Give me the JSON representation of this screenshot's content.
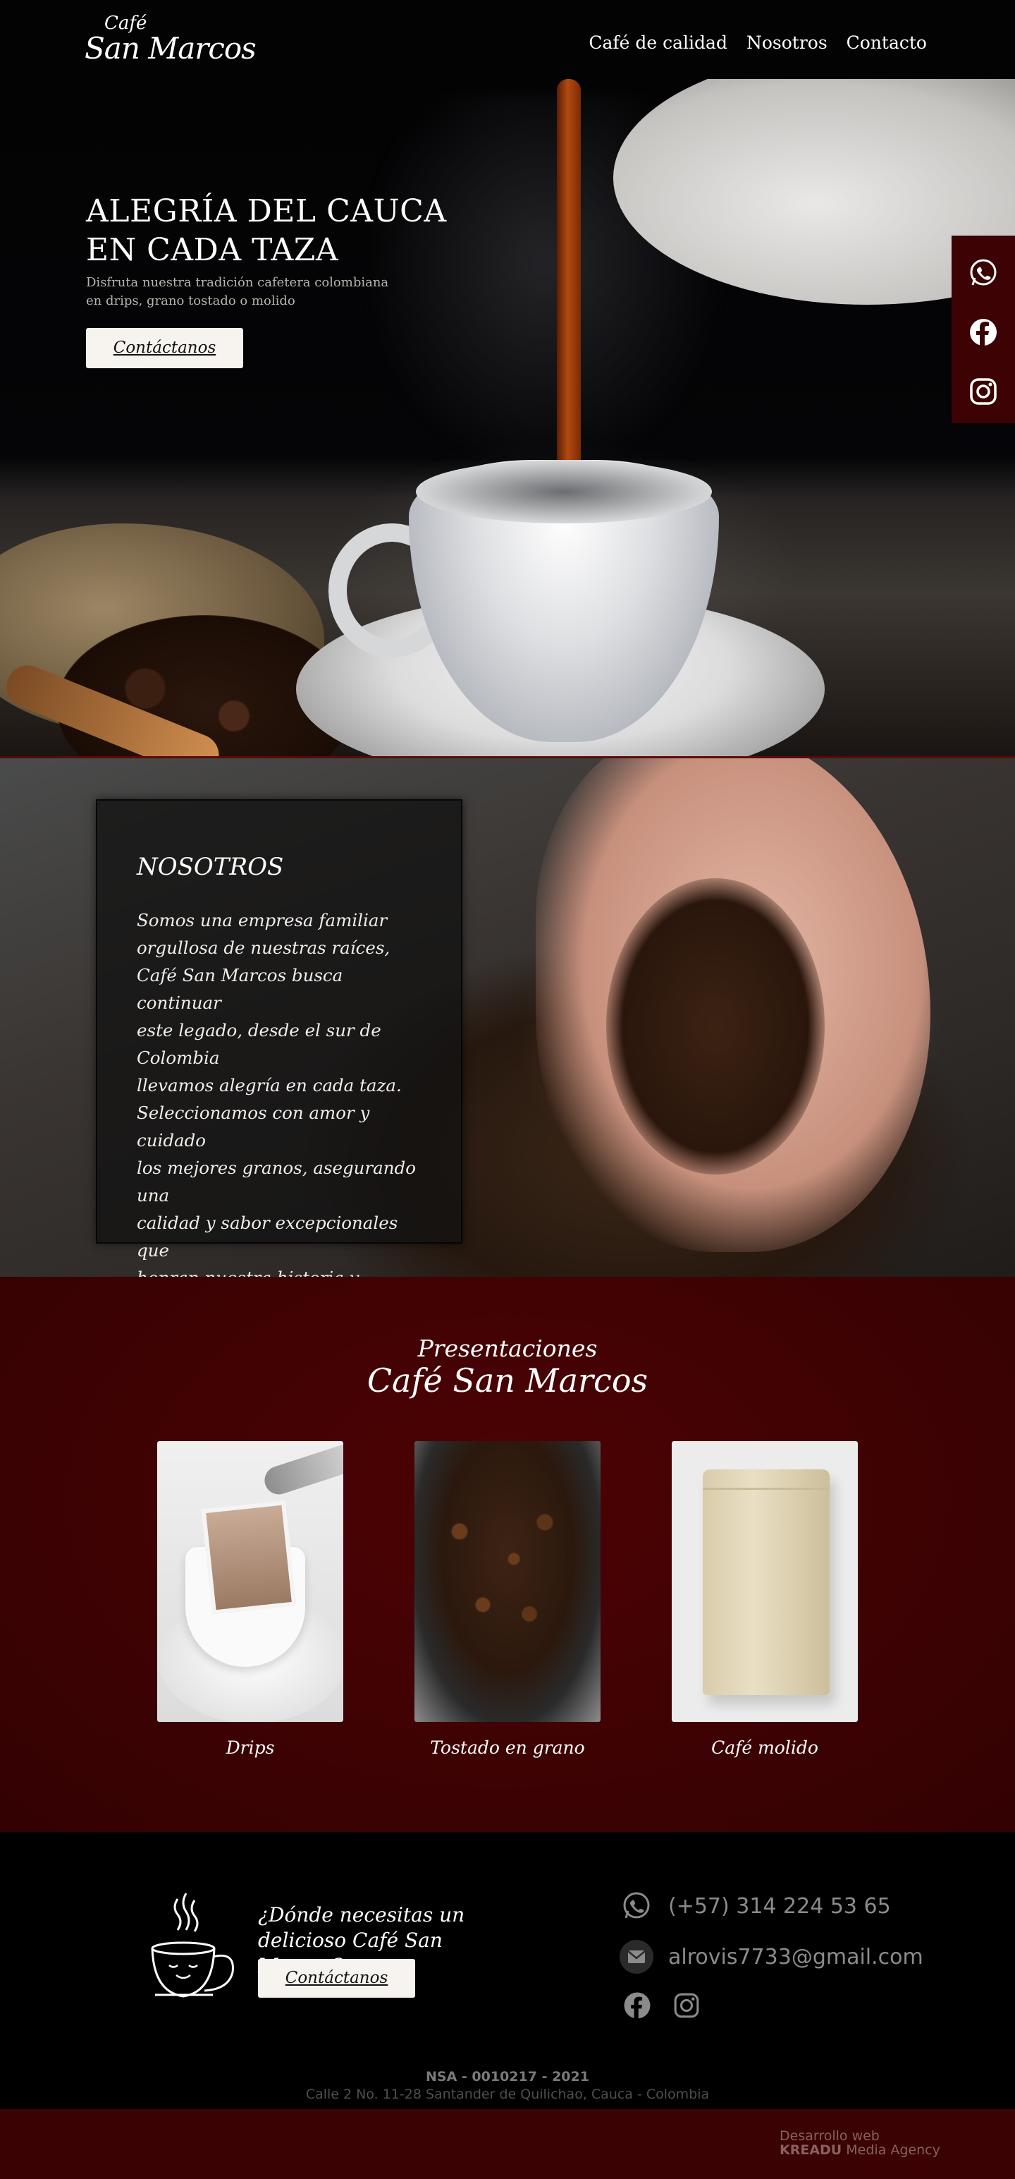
{
  "brand": {
    "logo_top": "Café",
    "logo_bottom": "San Marcos"
  },
  "nav": {
    "items": [
      "Café de calidad",
      "Nosotros",
      "Contacto"
    ]
  },
  "hero": {
    "title_line1": "ALEGRÍA DEL CAUCA",
    "title_line2": "EN CADA TAZA",
    "subtitle": "Disfruta nuestra tradición cafetera colombiana en drips, grano tostado o molido",
    "cta": "Contáctanos"
  },
  "social_bar": {
    "icons": [
      "whatsapp-icon",
      "facebook-icon",
      "instagram-icon"
    ]
  },
  "about": {
    "title": "NOSOTROS",
    "text": "Somos una empresa familiar\norgullosa de nuestras raíces,\nCafé San Marcos busca continuar\neste legado, desde el sur de Colombia\nllevamos alegría en cada taza.\nSeleccionamos con amor y cuidado\nlos mejores granos, asegurando una\ncalidad y sabor excepcionales que\nhonran nuestra historia y deleitan a\nnuestros clientes."
  },
  "presentaciones": {
    "kicker": "Presentaciones",
    "title": "Café San Marcos",
    "products": [
      {
        "label": "Drips"
      },
      {
        "label": "Tostado en grano"
      },
      {
        "label": "Café molido"
      }
    ]
  },
  "contact": {
    "question": "¿Dónde necesitas un delicioso Café San Marcos?",
    "cta": "Contáctanos",
    "phone": "(+57) 314 224 53 65",
    "email": "alrovis7733@gmail.com",
    "nsa": "NSA - 0010217 - 2021",
    "address": "Calle 2 No. 11-28 Santander de Quilichao, Cauca - Colombia"
  },
  "footer": {
    "credit_line1": "Desarrollo web",
    "credit_brand": "KREADU",
    "credit_rest": " Media Agency"
  },
  "colors": {
    "brand_red": "#3d0304",
    "background": "#000000",
    "button": "#f7f3ee"
  }
}
